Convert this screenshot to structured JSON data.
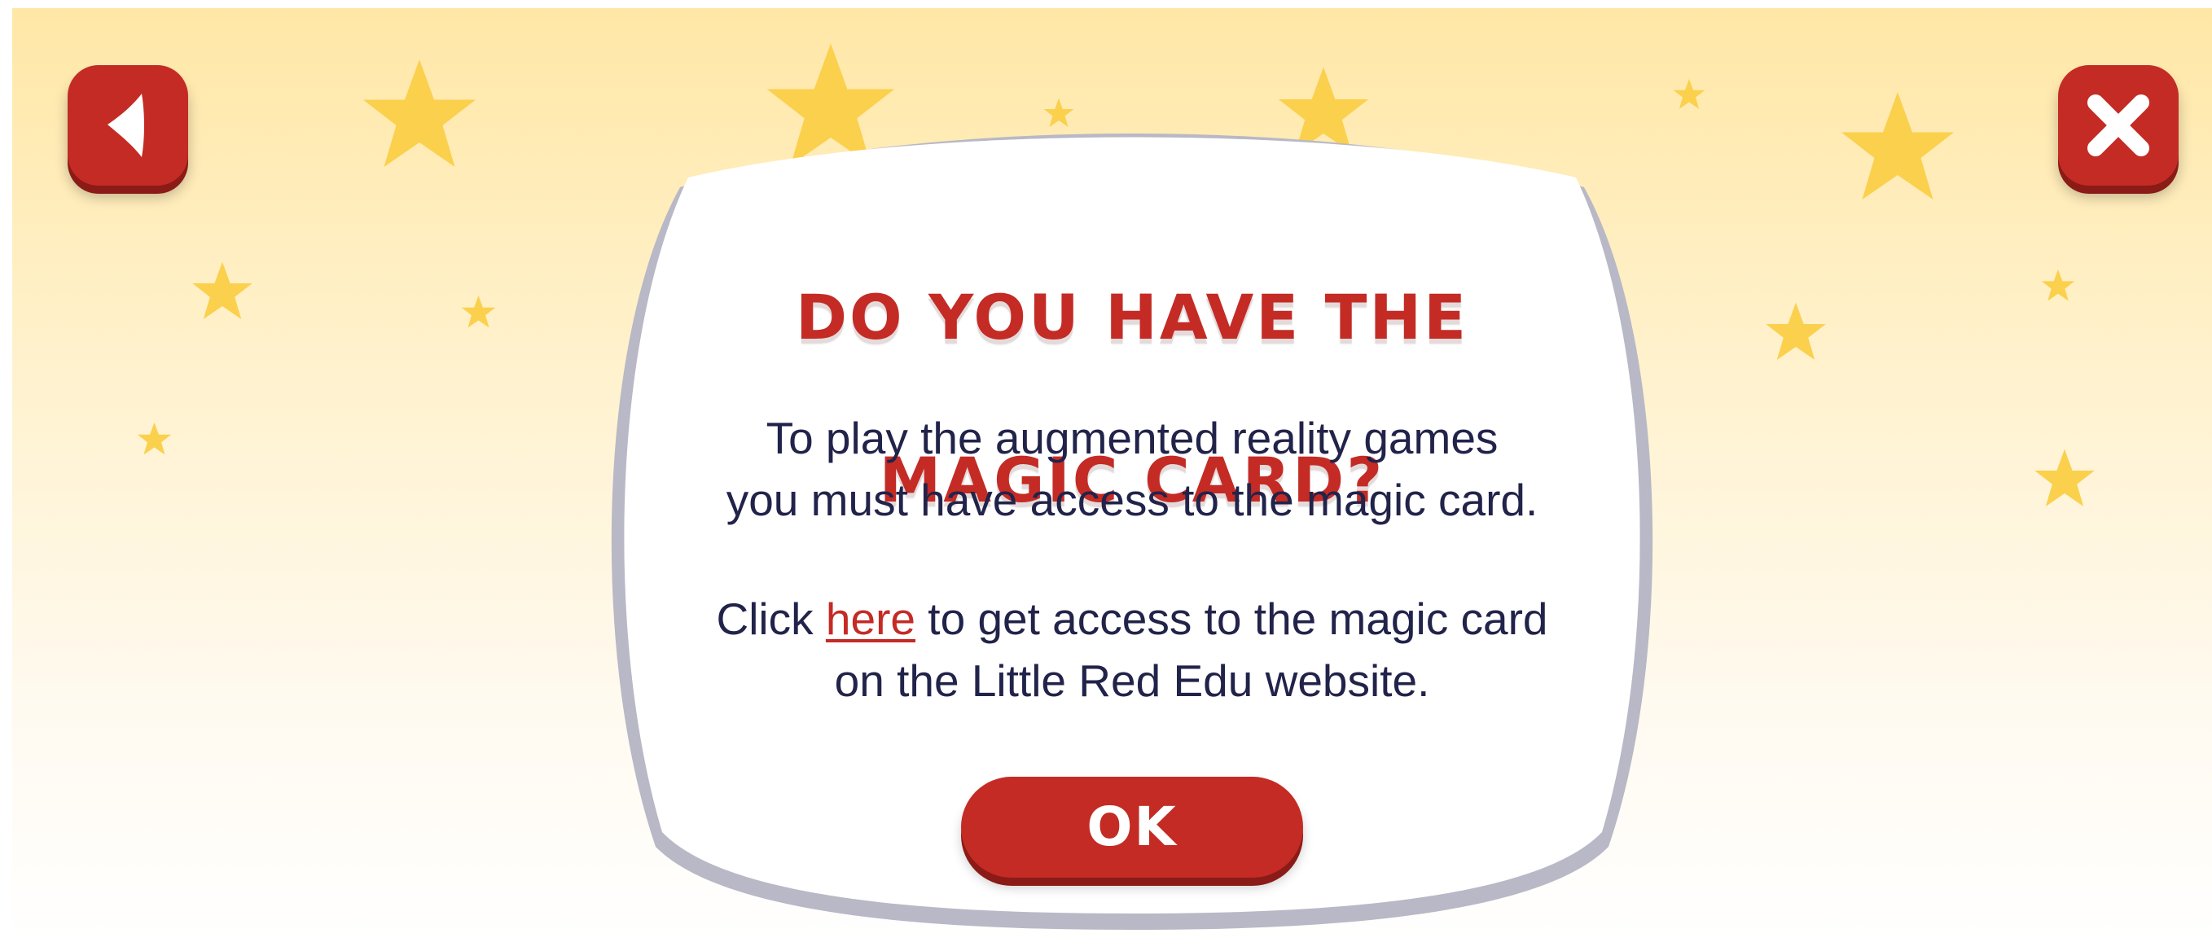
{
  "colors": {
    "accent_red": "#c42b25",
    "text_navy": "#22234a",
    "star_yellow": "#fbd04d",
    "background_top": "#ffe7a6",
    "card_white": "#ffffff"
  },
  "nav": {
    "back_icon": "back-arrow-icon",
    "close_icon": "close-x-icon"
  },
  "dialog": {
    "title_line1": "DO YOU HAVE THE",
    "title_line2": "MAGIC CARD?",
    "para1_line1": "To play the augmented reality games",
    "para1_line2": "you must have access to the magic card.",
    "para2_prefix": "Click ",
    "para2_link": "here",
    "para2_suffix": " to get access to the magic card",
    "para2_line2": "on the Little Red Edu website.",
    "ok_label": "OK"
  }
}
